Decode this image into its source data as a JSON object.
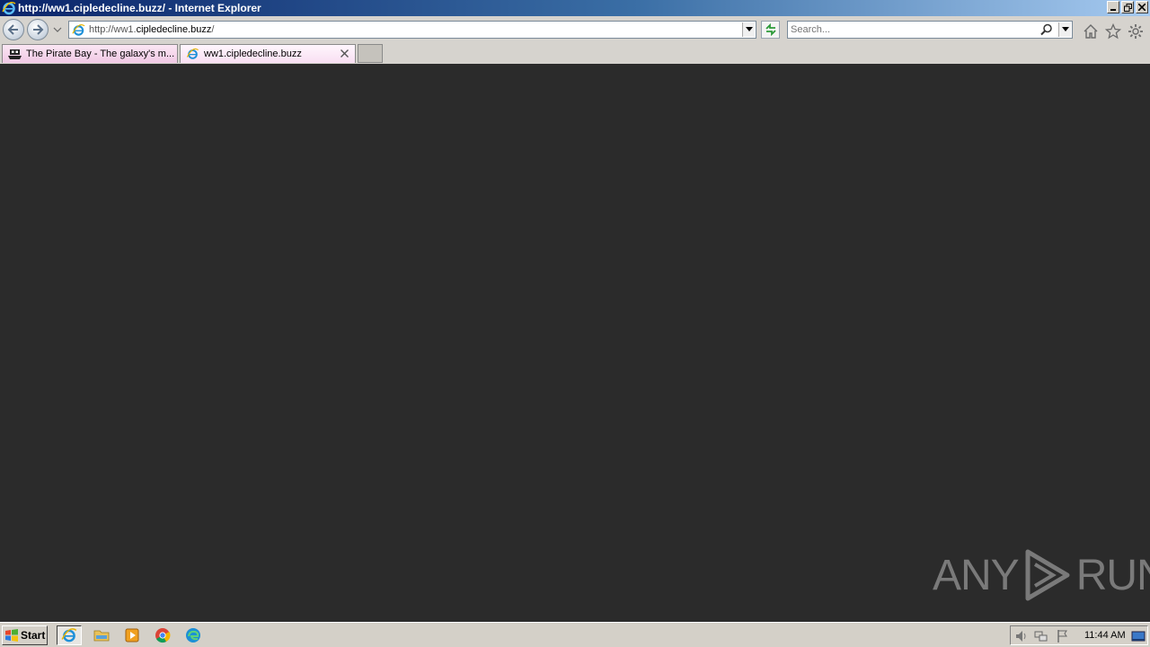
{
  "window": {
    "title": "http://ww1.cipledecline.buzz/ - Internet Explorer"
  },
  "navbar": {
    "address_prefix": "http://ww1.",
    "address_domain": "cipledecline.buzz",
    "address_suffix": "/",
    "search_placeholder": "Search..."
  },
  "tabs": [
    {
      "label": "The Pirate Bay - The galaxy's m...",
      "icon": "pirate-ship-icon",
      "active": false
    },
    {
      "label": "ww1.cipledecline.buzz",
      "icon": "ie-icon",
      "active": true
    }
  ],
  "watermark": {
    "left": "ANY",
    "right": "RUN"
  },
  "taskbar": {
    "start_label": "Start",
    "clock": "11:44 AM"
  },
  "colors": {
    "page_bg": "#2b2b2b",
    "chrome_bg": "#d6d3ce",
    "title_start": "#0a246a",
    "title_end": "#a6caf0"
  }
}
